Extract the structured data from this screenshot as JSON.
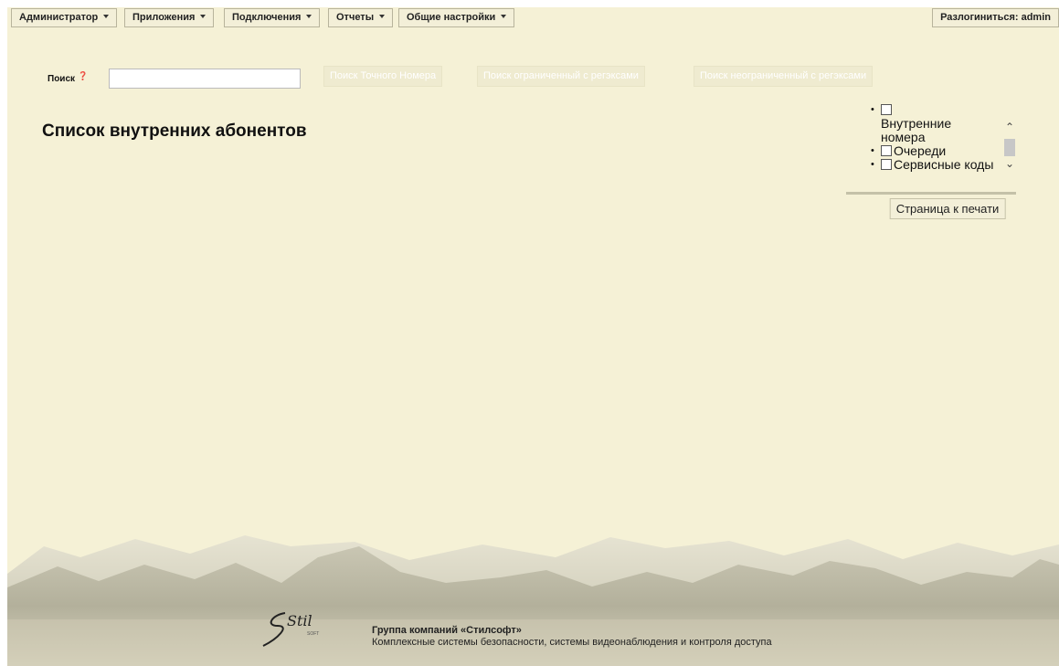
{
  "menu": {
    "items": [
      {
        "label": "Администратор"
      },
      {
        "label": "Приложения"
      },
      {
        "label": "Подключения"
      },
      {
        "label": "Отчеты"
      },
      {
        "label": "Общие настройки"
      }
    ],
    "logout_label": "Разлогиниться: admin"
  },
  "search": {
    "label": "Поиск",
    "help_glyph": "❓",
    "value": "",
    "placeholder": "",
    "buttons": [
      {
        "label": "Поиск Точного Номера"
      },
      {
        "label": "Поиск ограниченный с регэксами"
      },
      {
        "label": "Поиск неограниченный с регэксами"
      }
    ]
  },
  "main": {
    "title": "Список внутренних абонентов"
  },
  "filters": {
    "items": [
      {
        "label": "Внутренние номера",
        "checked": false
      },
      {
        "label": "Очереди",
        "checked": false
      },
      {
        "label": "Сервисные коды",
        "checked": false
      }
    ],
    "print_label": "Страница к печати"
  },
  "footer": {
    "company_name": "Группа компаний «Стилсофт»",
    "company_desc": "Комплексные системы безопасности, системы видеонаблюдения и контроля доступа",
    "logo_text": "Stil",
    "logo_subtext": "SOFT"
  },
  "colors": {
    "background": "#f5f1d6",
    "menu_bg": "#f3efd8",
    "disabled_button_text": "#ffffff"
  }
}
